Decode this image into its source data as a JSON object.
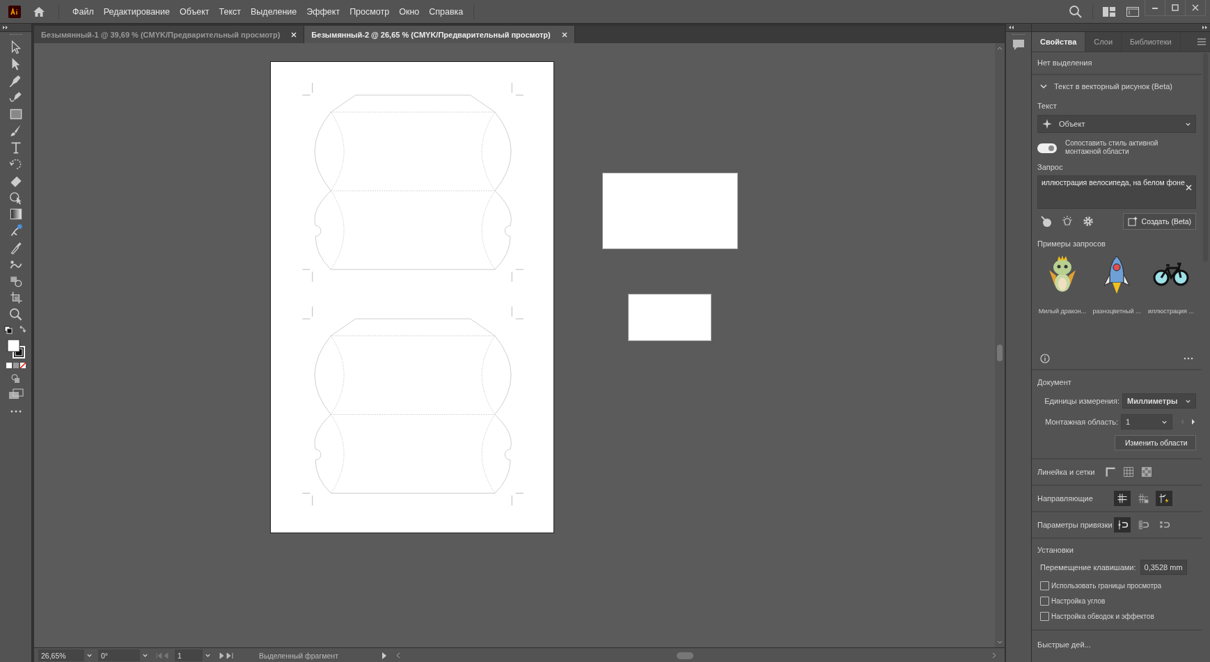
{
  "menu": [
    "Файл",
    "Редактирование",
    "Объект",
    "Текст",
    "Выделение",
    "Эффект",
    "Просмотр",
    "Окно",
    "Справка"
  ],
  "document_tabs": [
    {
      "label": "Безымянный-1 @ 39,69 % (CMYK/Предварительный просмотр)",
      "selected": false
    },
    {
      "label": "Безымянный-2 @ 26,65 % (CMYK/Предварительный просмотр)",
      "selected": true
    }
  ],
  "panel_tabs": [
    {
      "label": "Свойства",
      "selected": true
    },
    {
      "label": "Слои",
      "selected": false
    },
    {
      "label": "Библиотеки",
      "selected": false
    }
  ],
  "properties": {
    "selection_status": "Нет выделения",
    "text_to_vector": {
      "title": "Текст в векторный рисунок (Beta)",
      "expanded": true,
      "type_label": "Текст",
      "type_value": "Объект",
      "match_style": {
        "label": "Сопоставить стиль активной монтажной области",
        "on": true
      },
      "prompt_label": "Запрос",
      "prompt_value": "иллюстрация велосипеда, на белом фоне",
      "generate_button": "Создать (Beta)",
      "samples_label": "Примеры запросов",
      "samples": [
        {
          "kind": "dragon",
          "caption": "Милый дракон..."
        },
        {
          "kind": "rocket",
          "caption": "разноцветный ..."
        },
        {
          "kind": "bicycle",
          "caption": "иллюстрация ..."
        }
      ]
    },
    "document": {
      "title": "Документ",
      "units_label": "Единицы измерения:",
      "units_value": "Миллиметры",
      "artboard_label": "Монтажная область:",
      "artboard_value": "1",
      "edit_button": "Изменить области"
    },
    "rulers_label": "Линейка и сетки",
    "guides": {
      "label": "Направляющие",
      "buttons": [
        {
          "kind": "guides",
          "on": true
        },
        {
          "kind": "lock",
          "on": false
        },
        {
          "kind": "smart",
          "on": true
        }
      ]
    },
    "snap": {
      "label": "Параметры привязки",
      "buttons": [
        {
          "kind": "point",
          "on": true
        },
        {
          "kind": "pixel",
          "on": false
        },
        {
          "kind": "glyph",
          "on": false
        }
      ]
    },
    "preferences": {
      "title": "Установки",
      "nudge_label": "Перемещение клавишами:",
      "nudge_value": "0,3528 mm",
      "options": [
        {
          "label": "Использовать границы просмотра",
          "checked": false
        },
        {
          "label": "Настройка углов",
          "checked": false
        },
        {
          "label": "Настройка обводок и эффектов",
          "checked": false
        }
      ]
    },
    "quick_actions": "Быстрые дей..."
  },
  "status_bar": {
    "zoom": "26,65%",
    "rotation": "0°",
    "artboard": "1",
    "tool": "Выделенный фрагмент"
  }
}
